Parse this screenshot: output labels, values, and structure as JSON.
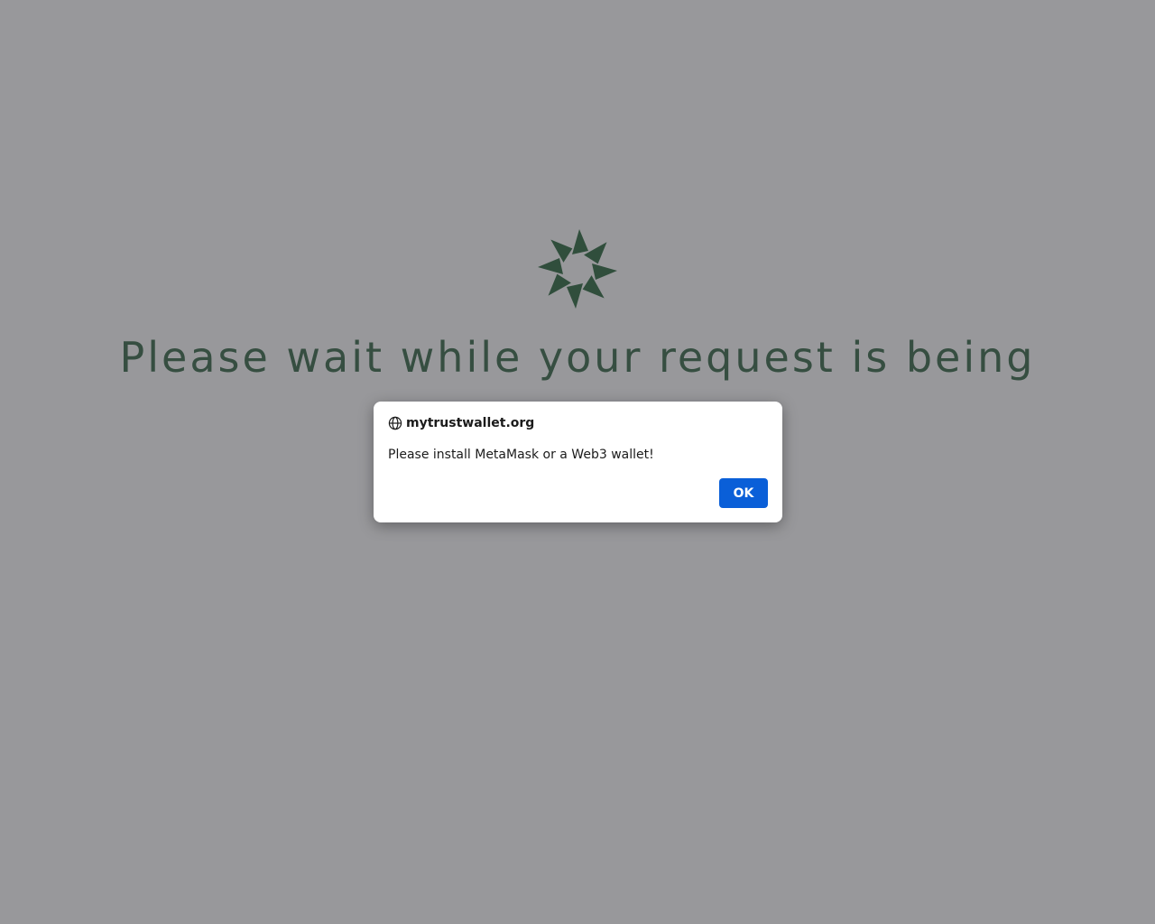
{
  "page": {
    "headline": "Please wait while your request is being",
    "spinner_icon": "loading-spinner-icon",
    "accent_color": "#3a6b4a"
  },
  "dialog": {
    "origin": "mytrustwallet.org",
    "origin_icon": "globe-icon",
    "message": "Please install MetaMask or a Web3 wallet!",
    "ok_label": "OK",
    "button_color": "#0a5fd8"
  }
}
